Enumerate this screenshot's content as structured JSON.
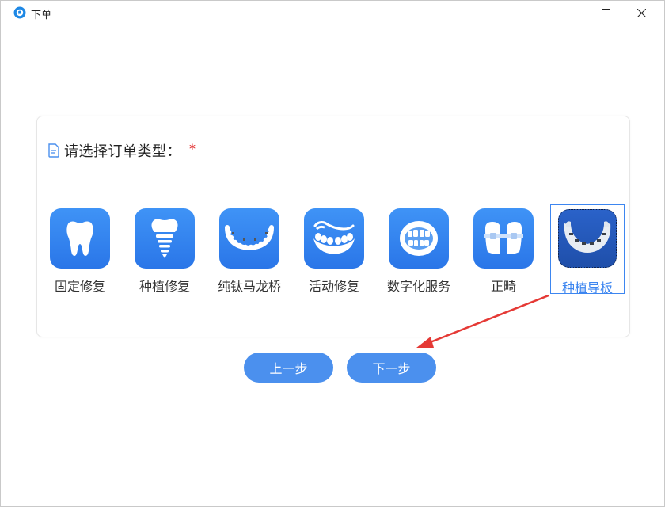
{
  "window": {
    "title": "下单"
  },
  "form": {
    "prompt": "请选择订单类型：",
    "required_mark": "*"
  },
  "order_types": [
    {
      "label": "固定修复",
      "icon": "tooth-icon"
    },
    {
      "label": "种植修复",
      "icon": "implant-icon"
    },
    {
      "label": "纯钛马龙桥",
      "icon": "titanium-bridge-icon"
    },
    {
      "label": "活动修复",
      "icon": "removable-denture-icon"
    },
    {
      "label": "数字化服务",
      "icon": "digital-smile-icon"
    },
    {
      "label": "正畸",
      "icon": "orthodontic-icon"
    },
    {
      "label": "种植导板",
      "icon": "surgical-guide-icon",
      "selected": true
    }
  ],
  "buttons": {
    "prev_label": "上一步",
    "next_label": "下一步"
  },
  "colors": {
    "accent": "#4b90ee",
    "tile": "#2f80ed",
    "required": "#e02020",
    "annotation_arrow": "#e53935"
  }
}
